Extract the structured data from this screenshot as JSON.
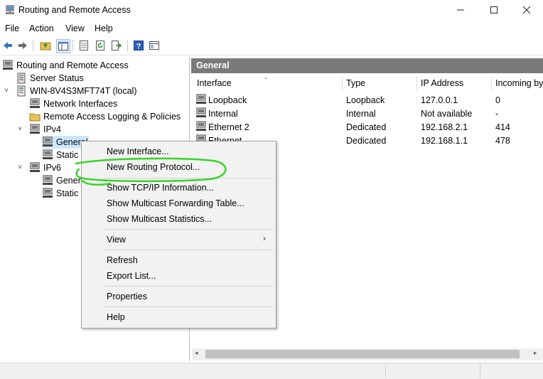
{
  "window": {
    "title": "Routing and Remote Access",
    "controls": {
      "minimize": "—",
      "maximize": "☐",
      "close": "✕"
    }
  },
  "menu": [
    "File",
    "Action",
    "View",
    "Help"
  ],
  "toolbar_icons": [
    "back-arrow-icon",
    "forward-arrow-icon",
    "up-folder-icon",
    "show-hide-tree-icon",
    "properties-icon",
    "refresh-icon",
    "export-list-icon",
    "help-icon",
    "console-tree-icon"
  ],
  "tree": {
    "root": "Routing and Remote Access",
    "server_status": "Server Status",
    "server": "WIN-8V4S3MFT74T (local)",
    "network_interfaces": "Network Interfaces",
    "remote_logging": "Remote Access Logging & Policies",
    "ipv4": "IPv4",
    "ipv4_general": "General",
    "ipv4_static": "Static R",
    "ipv6": "IPv6",
    "ipv6_general": "Genera",
    "ipv6_static": "Static R"
  },
  "pane": {
    "header": "General",
    "columns": [
      "Interface",
      "Type",
      "IP Address",
      "Incoming by"
    ],
    "rows": [
      {
        "interface": "Loopback",
        "type": "Loopback",
        "ip": "127.0.0.1",
        "incoming": "0"
      },
      {
        "interface": "Internal",
        "type": "Internal",
        "ip": "Not available",
        "incoming": "-"
      },
      {
        "interface": "Ethernet 2",
        "type": "Dedicated",
        "ip": "192.168.2.1",
        "incoming": "414"
      },
      {
        "interface": "Ethernet",
        "type": "Dedicated",
        "ip": "192.168.1.1",
        "incoming": "478"
      }
    ]
  },
  "context_menu": {
    "items": [
      "New Interface...",
      "New Routing Protocol...",
      "Show TCP/IP Information...",
      "Show Multicast Forwarding Table...",
      "Show Multicast Statistics...",
      "View",
      "Refresh",
      "Export List...",
      "Properties",
      "Help"
    ],
    "highlight_color": "#3ad12c"
  },
  "colors": {
    "header_bg": "#7a7a7a",
    "selection": "#cce8ff",
    "menu_bg": "#f2f2f2"
  }
}
